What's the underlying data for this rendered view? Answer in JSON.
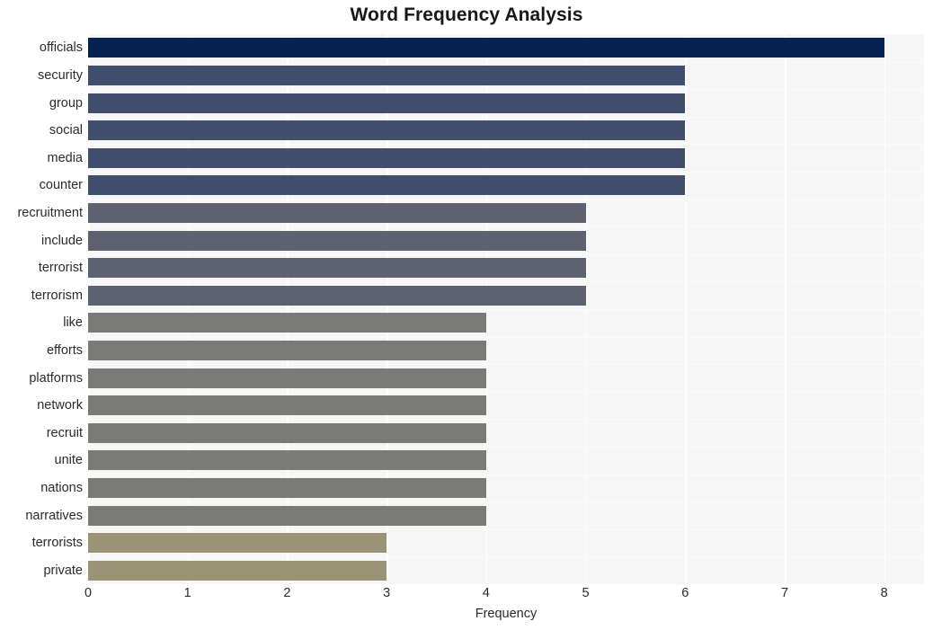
{
  "chart_data": {
    "type": "bar",
    "orientation": "horizontal",
    "title": "Word Frequency Analysis",
    "xlabel": "Frequency",
    "ylabel": "",
    "xlim": [
      0,
      8.4
    ],
    "xticks": [
      0,
      1,
      2,
      3,
      4,
      5,
      6,
      7,
      8
    ],
    "xtick_labels": [
      "0",
      "1",
      "2",
      "3",
      "4",
      "5",
      "6",
      "7",
      "8"
    ],
    "grid": true,
    "grid_color": "#fefeff",
    "plot_background": "#f6f6f7",
    "figure_background": "#ffffff",
    "legend": null,
    "categories": [
      "officials",
      "security",
      "group",
      "social",
      "media",
      "counter",
      "recruitment",
      "include",
      "terrorist",
      "terrorism",
      "like",
      "efforts",
      "platforms",
      "network",
      "recruit",
      "unite",
      "nations",
      "narratives",
      "terrorists",
      "private"
    ],
    "values": [
      8,
      6,
      6,
      6,
      6,
      6,
      5,
      5,
      5,
      5,
      4,
      4,
      4,
      4,
      4,
      4,
      4,
      4,
      3,
      3
    ],
    "bar_colors": [
      "#052250",
      "#414e6e",
      "#414e6e",
      "#414e6e",
      "#414e6e",
      "#414e6e",
      "#5e6270",
      "#5e6270",
      "#5e6270",
      "#5e6270",
      "#7a7a78",
      "#7a7a78",
      "#7a7a78",
      "#7a7a78",
      "#7a7a78",
      "#7a7a78",
      "#7a7a78",
      "#7a7a78",
      "#9a9375",
      "#9a9375"
    ]
  }
}
